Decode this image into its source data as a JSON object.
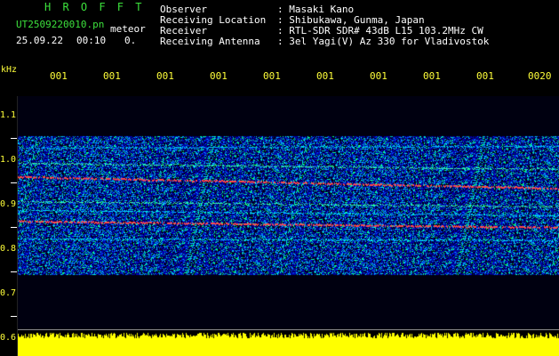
{
  "header": {
    "app_title": "H R O F F T",
    "file_name": "UT2509220010.pn",
    "meteor_label": "meteor",
    "date": "25.09.22",
    "time": "00:10",
    "meteor_count": "0.",
    "fields": [
      {
        "label": "Observer",
        "value": ": Masaki Kano"
      },
      {
        "label": "Receiving Location",
        "value": ": Shibukawa, Gunma, Japan"
      },
      {
        "label": "Receiver",
        "value": ": RTL-SDR SDR# 43dB L15 103.2MHz CW"
      },
      {
        "label": "Receiving Antenna",
        "value": ": 3el Yagi(V) Az 330 for Vladivostok"
      }
    ]
  },
  "axis": {
    "unit": "kHz",
    "y_ticks": [
      "1.1",
      "1.0",
      "0.9",
      "0.8",
      "0.7",
      "0.6"
    ],
    "x_ticks": [
      "001",
      "001",
      "001",
      "001",
      "001",
      "001",
      "001",
      "001",
      "001",
      "0020"
    ]
  },
  "colors": {
    "background": "#000000",
    "header_text": "#3ce03c",
    "info_text": "#ffffff",
    "axis_text": "#ffff3a",
    "power_bar": "#ffff00"
  }
}
